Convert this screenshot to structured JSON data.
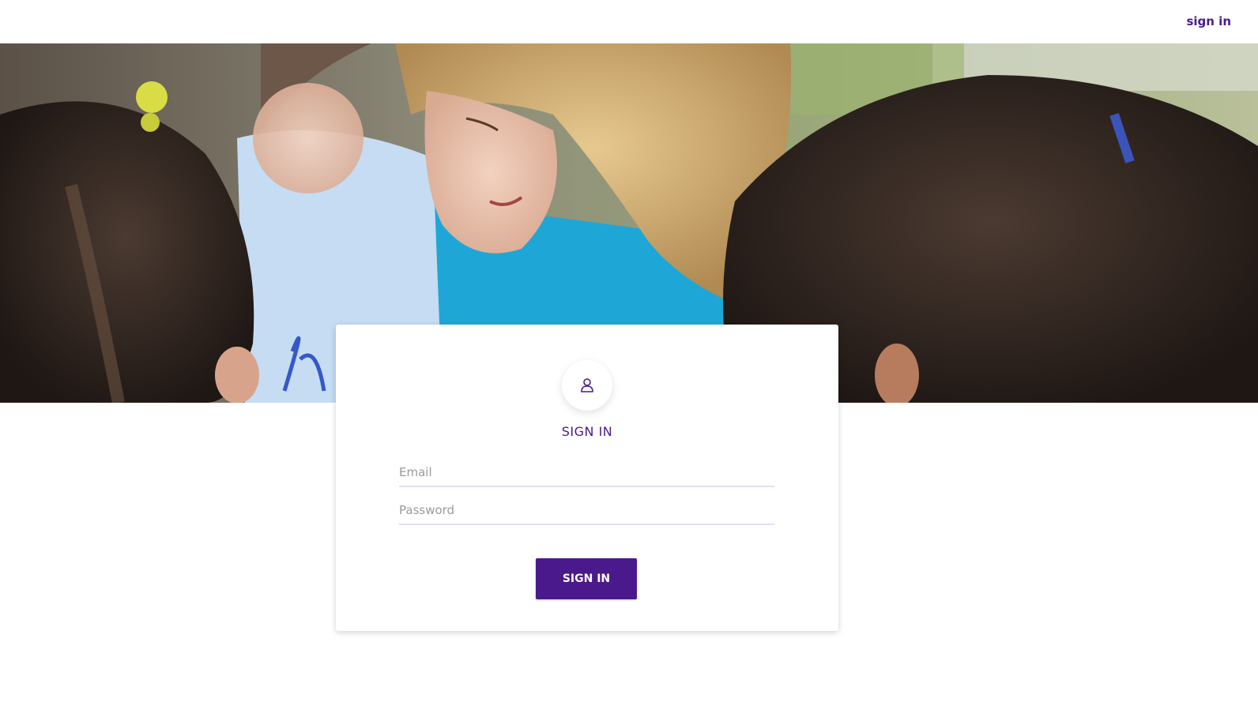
{
  "nav": {
    "signin_label": "sign in"
  },
  "hero": {
    "image": "photo of children and a woman reading together outdoors"
  },
  "card": {
    "icon": "user-icon",
    "title": "SIGN IN",
    "email_placeholder": "Email",
    "password_placeholder": "Password",
    "submit_label": "SIGN IN"
  },
  "colors": {
    "accent": "#4a1a8c",
    "input_underline": "#e3defa",
    "background": "#ffffff"
  }
}
